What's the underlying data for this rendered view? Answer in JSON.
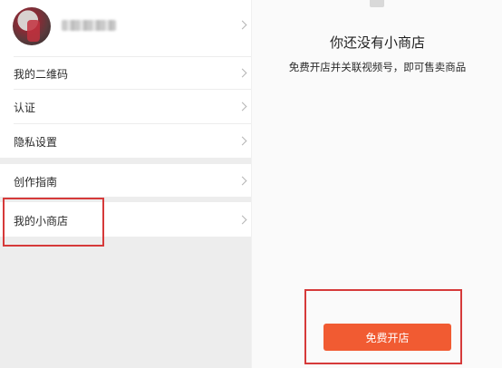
{
  "colors": {
    "accent": "#f15b32",
    "highlight": "#d63a3a",
    "divider": "#ececec",
    "background": "#ededed"
  },
  "profile": {
    "avatar_icon": "avatar",
    "name_obscured": true
  },
  "menu": {
    "group1": [
      {
        "id": "qrcode",
        "label": "我的二维码"
      },
      {
        "id": "verify",
        "label": "认证"
      },
      {
        "id": "privacy",
        "label": "隐私设置"
      }
    ],
    "group2": [
      {
        "id": "guide",
        "label": "创作指南"
      }
    ],
    "group3": [
      {
        "id": "shop",
        "label": "我的小商店"
      }
    ]
  },
  "shop_page": {
    "title": "你还没有小商店",
    "description": "免费开店并关联视频号，即可售卖商品",
    "open_button_label": "免费开店"
  }
}
